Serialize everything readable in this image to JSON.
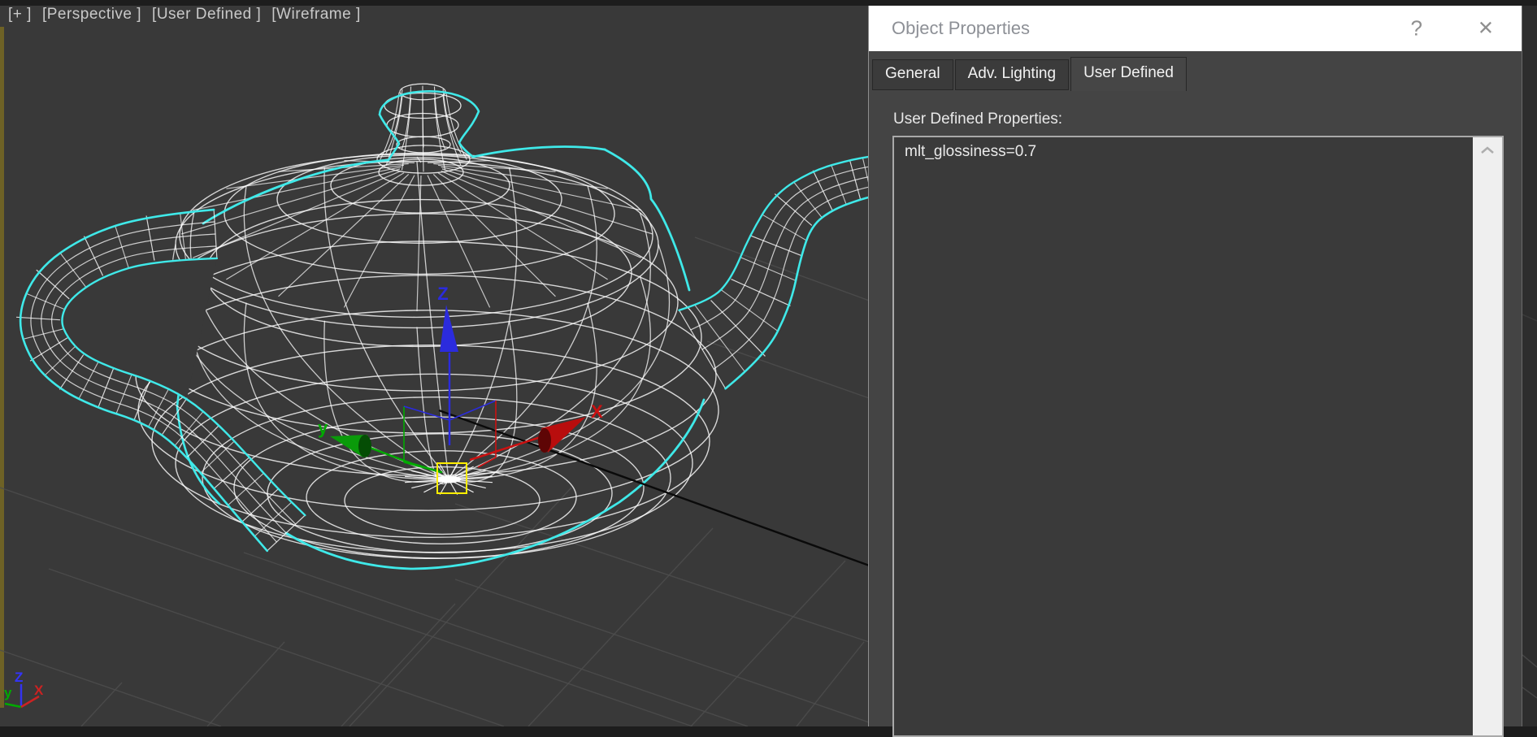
{
  "viewport": {
    "menus": [
      {
        "label": "[+ ]"
      },
      {
        "label": "[Perspective ]"
      },
      {
        "label": "[User Defined ]"
      },
      {
        "label": "[Wireframe ]"
      }
    ],
    "axis_tripod": {
      "x": "X",
      "y": "y",
      "z": "Z"
    },
    "gizmo_labels": {
      "x": "X",
      "y": "y",
      "z": "Z"
    }
  },
  "dialog": {
    "title": "Object Properties",
    "help_label": "?",
    "close_label": "✕",
    "tabs": [
      {
        "label": "General",
        "active": false
      },
      {
        "label": "Adv. Lighting",
        "active": false
      },
      {
        "label": "User Defined",
        "active": true
      }
    ],
    "user_defined": {
      "properties_label": "User Defined Properties:",
      "properties_text": "mlt_glossiness=0.7"
    }
  },
  "colors": {
    "selection_outline": "#3fe9e9",
    "wireframe": "#ffffff",
    "axis_x": "#cc1111",
    "axis_y": "#00aa00",
    "axis_z": "#2b2bdd",
    "gizmo_center_box": "#ffee00",
    "viewport_active_border": "#6e6226",
    "grid_line": "#4d4d4d",
    "grid_axis_black": "#0a0a0a",
    "scrollbar_track": "#efefef",
    "viewport_bg": "#393939"
  }
}
